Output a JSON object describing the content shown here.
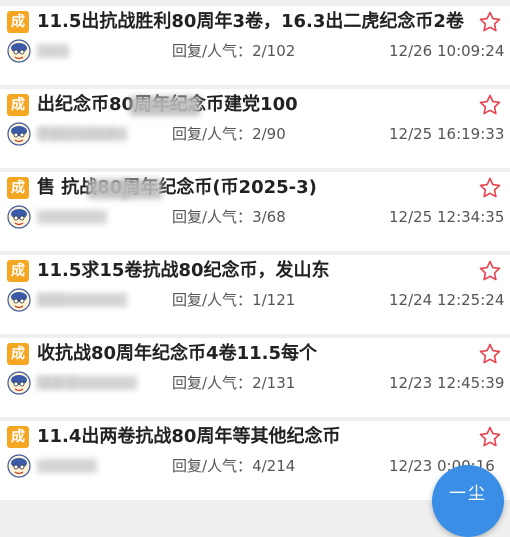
{
  "colors": {
    "badge": "#f5a623",
    "star": "#e8414f",
    "fab": "#3a8ee6"
  },
  "posts": [
    {
      "badge": "成",
      "title": "11.5出抗战胜利80周年3卷，16.3出二虎纪念币2卷",
      "user": "",
      "stats_label": "回复/人气：",
      "stats": "2/102",
      "time": "12/26 10:09:24"
    },
    {
      "badge": "成",
      "title": "出纪念币80周年纪念币建党100",
      "user": "手到了1818",
      "stats_label": "回复/人气：",
      "stats": "2/90",
      "time": "12/25 16:19:33"
    },
    {
      "badge": "成",
      "title": "售 抗战80周年纪念币(币2025-3)",
      "user": "",
      "stats_label": "回复/人气：",
      "stats": "3/68",
      "time": "12/25 12:34:35"
    },
    {
      "badge": "成",
      "title": "11.5求15卷抗战80纪念币，发山东",
      "user": "123",
      "stats_label": "回复/人气：",
      "stats": "1/121",
      "time": "12/24 12:25:24"
    },
    {
      "badge": "成",
      "title": "收抗战80周年纪念币4卷11.5每个",
      "user": "球手了",
      "stats_label": "回复/人气：",
      "stats": "2/131",
      "time": "12/23 12:45:39"
    },
    {
      "badge": "成",
      "title": "11.4出两卷抗战80周年等其他纪念币",
      "user": "",
      "stats_label": "回复/人气：",
      "stats": "4/214",
      "time": "12/23 0:00:16"
    }
  ],
  "fab": {
    "label": "一尘"
  }
}
